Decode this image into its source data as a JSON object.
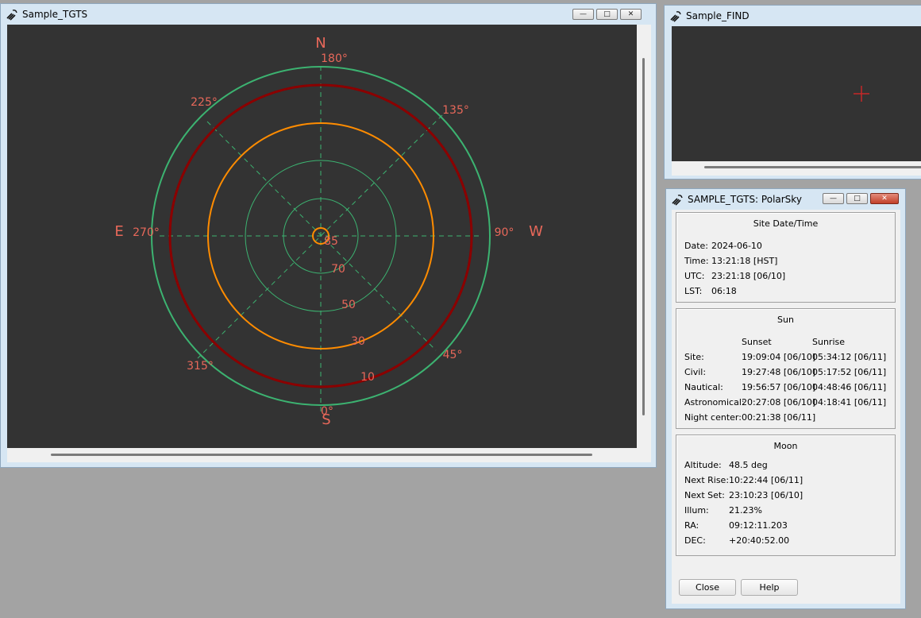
{
  "windows": {
    "tgts": {
      "title": "Sample_TGTS"
    },
    "find": {
      "title": "Sample_FIND"
    },
    "polar": {
      "title": "SAMPLE_TGTS: PolarSky"
    }
  },
  "plot": {
    "compass": {
      "north": "N",
      "south": "S",
      "east": "E",
      "west": "W"
    },
    "azimuth_labels": {
      "az180": "180°",
      "az135": "135°",
      "az90": "90°",
      "az45": "45°",
      "az0": "0°",
      "az315": "315°",
      "az270": "270°",
      "az225": "225°"
    },
    "elevation_labels": {
      "el85": "85",
      "el70": "70",
      "el50": "50",
      "el30": "30",
      "el10": "10"
    },
    "colors": {
      "background": "#333333",
      "grid": "#3cb371",
      "label": "#e8685a",
      "red_ring": "#8b0000",
      "orange_ring": "#ff8c00"
    }
  },
  "controls": {
    "minimize": "—",
    "maximize": "□",
    "close": "✕"
  },
  "site": {
    "title": "Site Date/Time",
    "date_label": "Date:",
    "date": "2024-06-10",
    "time_label": "Time:",
    "time": "13:21:18 [HST]",
    "utc_label": "UTC:",
    "utc": "23:21:18 [06/10]",
    "lst_label": "LST:",
    "lst": "06:18"
  },
  "sun": {
    "title": "Sun",
    "col_sunset": "Sunset",
    "col_sunrise": "Sunrise",
    "rows": [
      {
        "label": "Site:",
        "sunset": "19:09:04 [06/10]",
        "sunrise": "05:34:12 [06/11]"
      },
      {
        "label": "Civil:",
        "sunset": "19:27:48 [06/10]",
        "sunrise": "05:17:52 [06/11]"
      },
      {
        "label": "Nautical:",
        "sunset": "19:56:57 [06/10]",
        "sunrise": "04:48:46 [06/11]"
      },
      {
        "label": "Astronomical:",
        "sunset": "20:27:08 [06/10]",
        "sunrise": "04:18:41 [06/11]"
      }
    ],
    "night_label": "Night center:",
    "night": "00:21:38 [06/11]"
  },
  "moon": {
    "title": "Moon",
    "rows": [
      {
        "label": "Altitude:",
        "value": "48.5 deg"
      },
      {
        "label": "Next Rise:",
        "value": "10:22:44 [06/11]"
      },
      {
        "label": "Next Set:",
        "value": "23:10:23 [06/10]"
      },
      {
        "label": "Illum:",
        "value": "21.23%"
      },
      {
        "label": "RA:",
        "value": "09:12:11.203"
      },
      {
        "label": "DEC:",
        "value": "+20:40:52.00"
      }
    ]
  },
  "buttons": {
    "close": "Close",
    "help": "Help"
  }
}
